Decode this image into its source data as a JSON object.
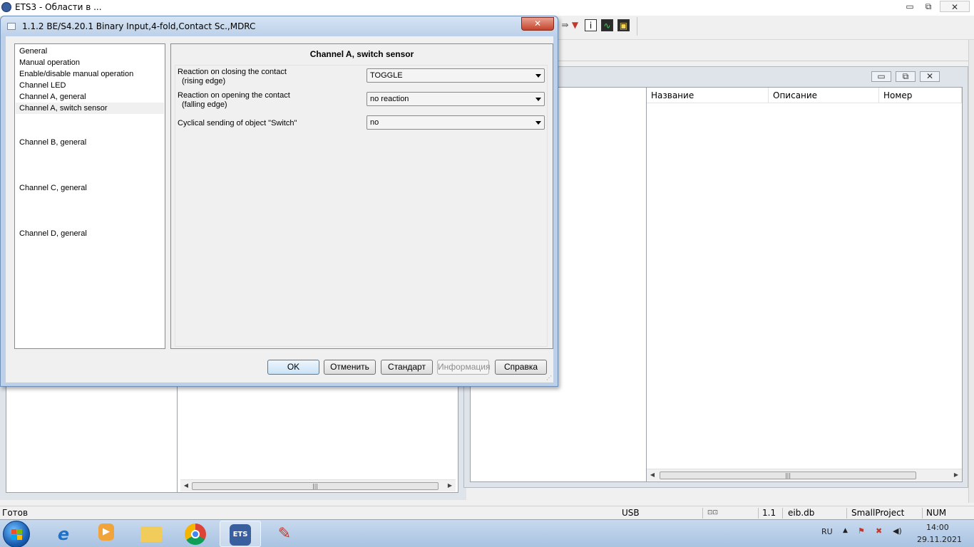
{
  "main_window": {
    "title": "ETS3 - Области в ...",
    "controls": {
      "minimize": "▭",
      "restore": "⧉",
      "close": "✕"
    }
  },
  "mdi_window": {
    "columns": [
      "Название",
      "Описание",
      "Номер"
    ],
    "controls": {
      "minimize": "▭",
      "restore": "⧉",
      "close": "✕"
    }
  },
  "dialog": {
    "title": "1.1.2 BE/S4.20.1 Binary Input,4-fold,Contact Sc.,MDRC",
    "close": "✕",
    "nav_items": [
      {
        "label": "General"
      },
      {
        "label": "Manual operation"
      },
      {
        "label": "Enable/disable manual operation"
      },
      {
        "label": "Channel LED"
      },
      {
        "label": "Channel A, general"
      },
      {
        "label": "Channel A, switch sensor"
      },
      {
        "label": "Channel B, general"
      },
      {
        "label": "Channel C, general"
      },
      {
        "label": "Channel D, general"
      }
    ],
    "selected_item": "Channel A, switch sensor",
    "panel_title": "Channel A, switch sensor",
    "params": [
      {
        "label": "Reaction on closing the contact",
        "sublabel": "(rising edge)",
        "value": "TOGGLE"
      },
      {
        "label": "Reaction on opening the contact",
        "sublabel": "(falling edge)",
        "value": "no reaction"
      },
      {
        "label": "Cyclical sending of object \"Switch\"",
        "sublabel": "",
        "value": "no"
      }
    ],
    "buttons": {
      "ok": "OK",
      "cancel": "Отменить",
      "default": "Стандарт",
      "info": "Информация",
      "help": "Справка"
    }
  },
  "statusbar": {
    "status": "Готов",
    "interface": "USB",
    "address": "1.1",
    "database": "eib.db",
    "project": "SmallProject",
    "num": "NUM"
  },
  "taskbar": {
    "language": "RU",
    "time": "14:00",
    "date": "29.11.2021"
  }
}
